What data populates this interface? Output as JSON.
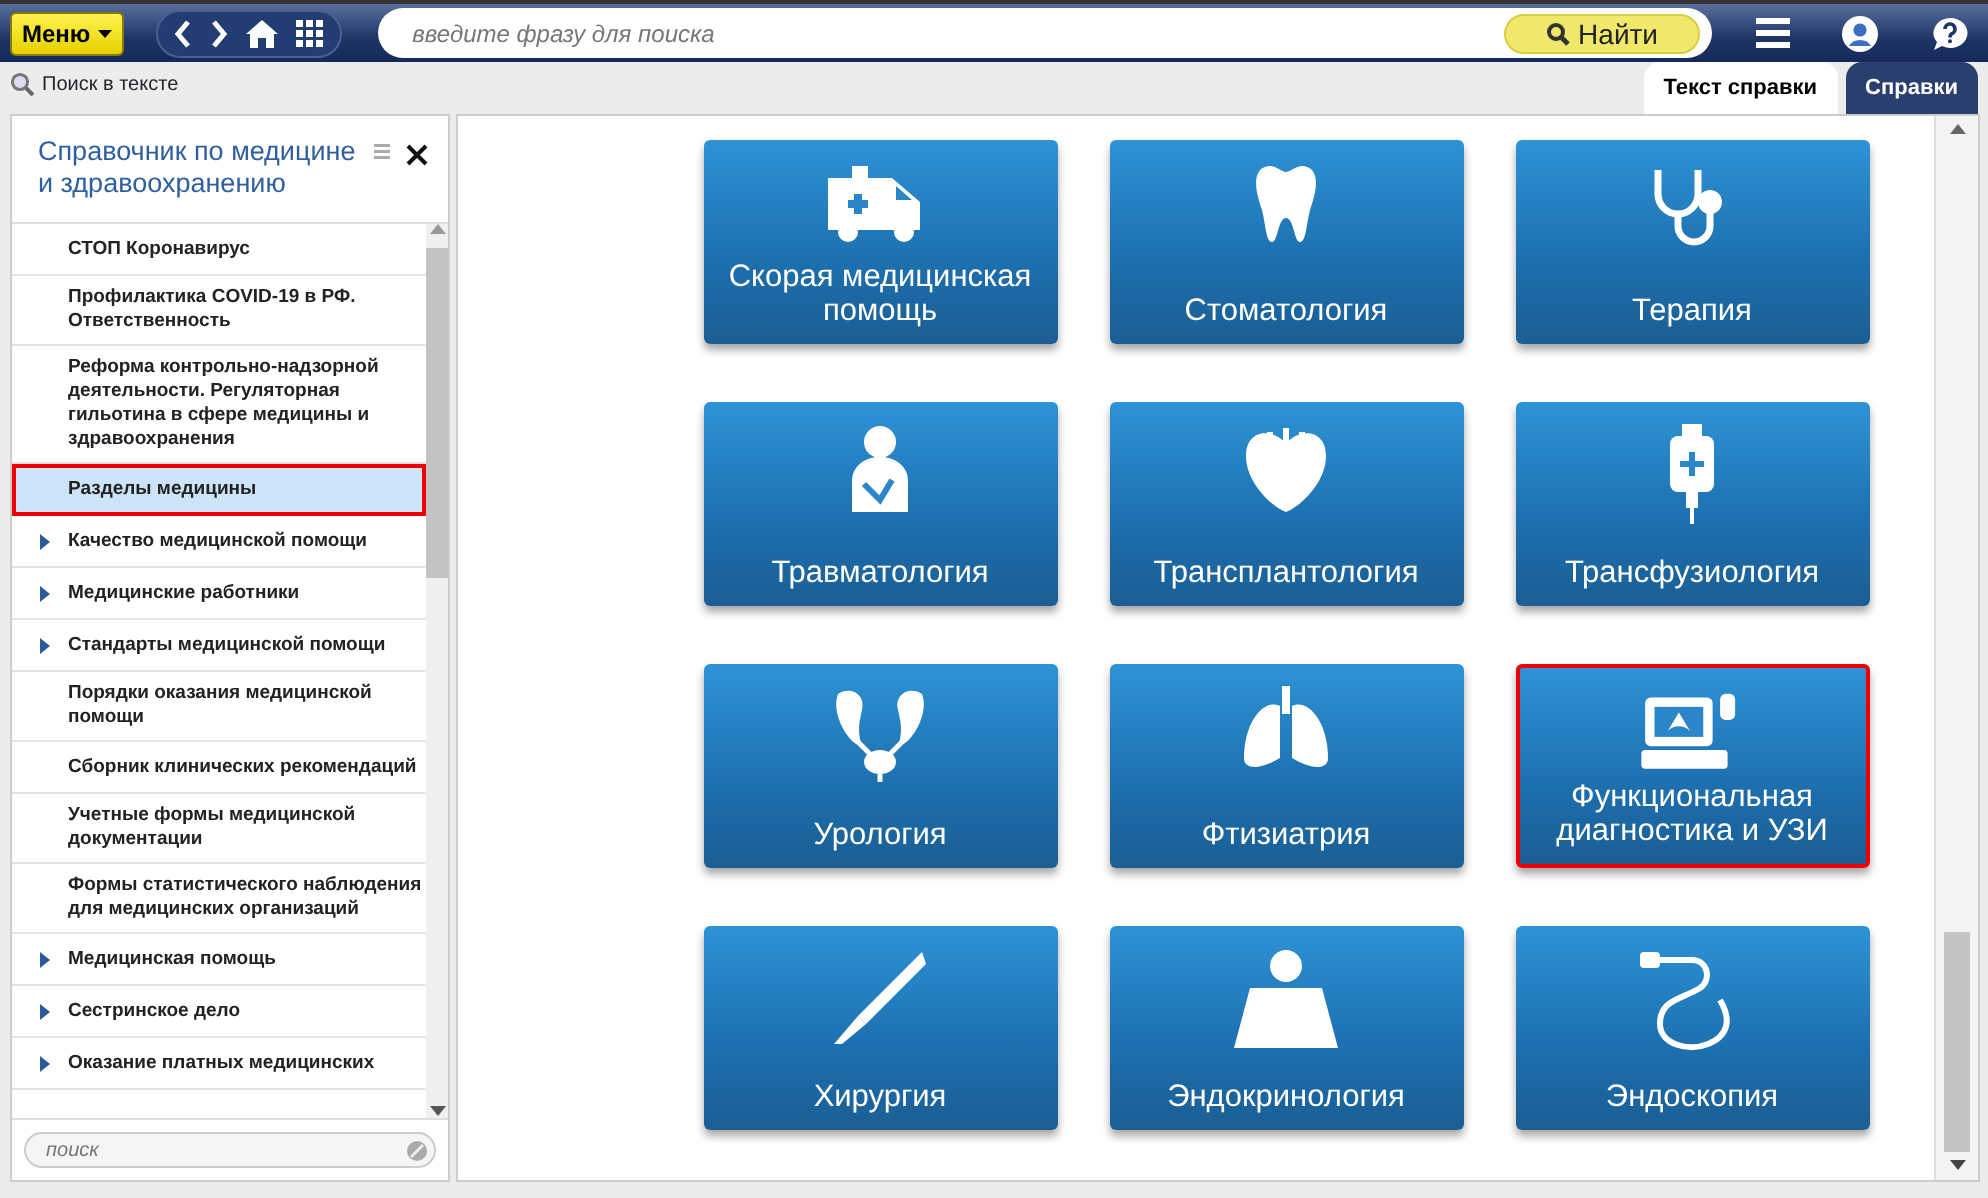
{
  "toolbar": {
    "menu_button": "Меню",
    "search": {
      "placeholder": "введите фразу для поиска"
    },
    "find_button": "Найти"
  },
  "subbar": {
    "text_search": "Поиск в тексте",
    "tabs": [
      {
        "label": "Текст справки",
        "selected": true
      },
      {
        "label": "Справки",
        "selected": false
      }
    ]
  },
  "sidebar": {
    "title": "Справочник по медицине и здравоохранению",
    "items": [
      {
        "label": "СТОП Коронавирус",
        "expandable": false,
        "selected": false
      },
      {
        "label": "Профилактика COVID-19 в РФ. Ответственность",
        "expandable": false,
        "selected": false
      },
      {
        "label": "Реформа контрольно-надзорной деятельности. Регуляторная гильотина в сфере медицины и здравоохранения",
        "expandable": false,
        "selected": false
      },
      {
        "label": "Разделы медицины",
        "expandable": false,
        "selected": true
      },
      {
        "label": "Качество медицинской помощи",
        "expandable": true,
        "selected": false
      },
      {
        "label": "Медицинские работники",
        "expandable": true,
        "selected": false
      },
      {
        "label": "Стандарты медицинской помощи",
        "expandable": true,
        "selected": false
      },
      {
        "label": "Порядки оказания медицинской помощи",
        "expandable": false,
        "selected": false
      },
      {
        "label": "Сборник клинических рекомендаций",
        "expandable": false,
        "selected": false
      },
      {
        "label": "Учетные формы медицинской документации",
        "expandable": false,
        "selected": false
      },
      {
        "label": "Формы статистического наблюдения для медицинских организаций",
        "expandable": false,
        "selected": false
      },
      {
        "label": "Медицинская помощь",
        "expandable": true,
        "selected": false
      },
      {
        "label": "Сестринское дело",
        "expandable": true,
        "selected": false
      },
      {
        "label": "Оказание платных медицинских",
        "expandable": true,
        "selected": false
      }
    ],
    "search": {
      "placeholder": "поиск"
    }
  },
  "tiles": [
    {
      "label": "Скорая медицинская помощь",
      "selected": false
    },
    {
      "label": "Стоматология",
      "selected": false
    },
    {
      "label": "Терапия",
      "selected": false
    },
    {
      "label": "Травматология",
      "selected": false
    },
    {
      "label": "Трансплантология",
      "selected": false
    },
    {
      "label": "Трансфузиология",
      "selected": false
    },
    {
      "label": "Урология",
      "selected": false
    },
    {
      "label": "Фтизиатрия",
      "selected": false
    },
    {
      "label": "Функциональная диагностика и УЗИ",
      "selected": true
    },
    {
      "label": "Хирургия",
      "selected": false
    },
    {
      "label": "Эндокринология",
      "selected": false
    },
    {
      "label": "Эндоскопия",
      "selected": false
    }
  ]
}
